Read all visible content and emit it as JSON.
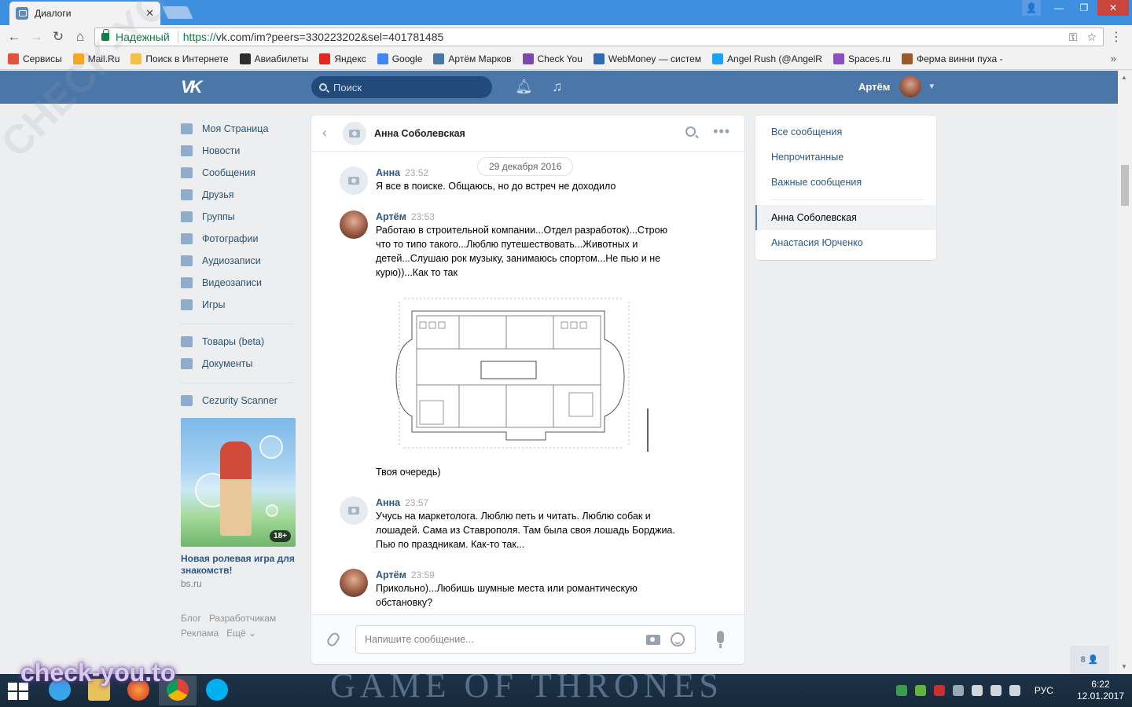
{
  "browser": {
    "tab_title": "Диалоги",
    "tab_close": "✕",
    "secure_label": "Надежный",
    "url_scheme": "https://",
    "url_rest": "vk.com/im?peers=330223202&sel=401781485",
    "win_minimize": "—",
    "win_restore": "❐",
    "win_close": "✕",
    "bookmarks": [
      {
        "label": "Сервисы",
        "color": "#e0533e"
      },
      {
        "label": "Mail.Ru",
        "color": "#f5a623"
      },
      {
        "label": "Поиск в Интернете",
        "color": "#f3c144"
      },
      {
        "label": "Авиабилеты",
        "color": "#2d2d2d"
      },
      {
        "label": "Яндекс",
        "color": "#e52620"
      },
      {
        "label": "Google",
        "color": "#4285f4"
      },
      {
        "label": "Артём Марков",
        "color": "#4a76a8"
      },
      {
        "label": "Check You",
        "color": "#7a4aa8"
      },
      {
        "label": "WebMoney — систем",
        "color": "#2f6bb5"
      },
      {
        "label": "Angel Rush (@AngelR",
        "color": "#1da1f2"
      },
      {
        "label": "Spaces.ru",
        "color": "#8b4fc1"
      },
      {
        "label": "Ферма винни пуха -",
        "color": "#9a5a2a"
      }
    ],
    "bookmarks_more": "»"
  },
  "header": {
    "logo": "VK",
    "search_placeholder": "Поиск",
    "user_name": "Артём"
  },
  "sidebar": {
    "items": [
      {
        "label": "Моя Страница",
        "icon": "home-icon"
      },
      {
        "label": "Новости",
        "icon": "news-icon"
      },
      {
        "label": "Сообщения",
        "icon": "messages-icon"
      },
      {
        "label": "Друзья",
        "icon": "friends-icon"
      },
      {
        "label": "Группы",
        "icon": "groups-icon"
      },
      {
        "label": "Фотографии",
        "icon": "photos-icon"
      },
      {
        "label": "Аудиозаписи",
        "icon": "music-icon"
      },
      {
        "label": "Видеозаписи",
        "icon": "video-icon"
      },
      {
        "label": "Игры",
        "icon": "games-icon"
      }
    ],
    "items2": [
      {
        "label": "Товары (beta)",
        "icon": "goods-icon"
      },
      {
        "label": "Документы",
        "icon": "docs-icon"
      }
    ],
    "apps": [
      {
        "label": "Cezurity Scanner",
        "icon": "app-grid-icon"
      }
    ],
    "ad": {
      "badge": "18+",
      "title": "Новая ролевая игра для знакомств!",
      "domain": "bs.ru"
    },
    "footer": {
      "blog": "Блог",
      "developers": "Разработчикам",
      "ads": "Реклама",
      "more": "Ещё ⌄"
    }
  },
  "chat": {
    "title": "Анна Соболевская",
    "date": "29 декабря 2016",
    "messages": [
      {
        "author": "Анна",
        "time": "23:52",
        "text": "Я все в поиске. Общаюсь, но до встреч не доходило"
      },
      {
        "author": "Артём",
        "time": "23:53",
        "text": "Работаю в строительной компании...Отдел разработок)...Строю что то типо такого...Люблю путешествовать...Животных и детей...Слушаю рок музыку, занимаюсь спортом...Не пью и не курю))...Как то так",
        "text2": "Твоя очередь)"
      },
      {
        "author": "Анна",
        "time": "23:57",
        "text": "Учусь на маркетолога. Люблю петь и читать. Люблю собак и лошадей. Сама из Ставрополя. Там была своя лошадь Борджиа. Пью по праздникам. Как-то так..."
      },
      {
        "author": "Артём",
        "time": "23:59",
        "text": "Прикольно)...Любишь шумные места или романтическую обстановку?"
      }
    ],
    "input_placeholder": "Напишите сообщение..."
  },
  "folders": {
    "items": [
      "Все сообщения",
      "Непрочитанные",
      "Важные сообщения"
    ],
    "dialogs": [
      "Анна Соболевская",
      "Анастасия Юрченко"
    ]
  },
  "counter": "8 👤",
  "taskbar": {
    "banner": "GAME OF THRONES",
    "lang": "РУС",
    "time": "6:22",
    "date": "12.01.2017"
  },
  "watermarks": {
    "diagonal": "CHECK-YOU.ME",
    "bottom": "check-you.to"
  }
}
